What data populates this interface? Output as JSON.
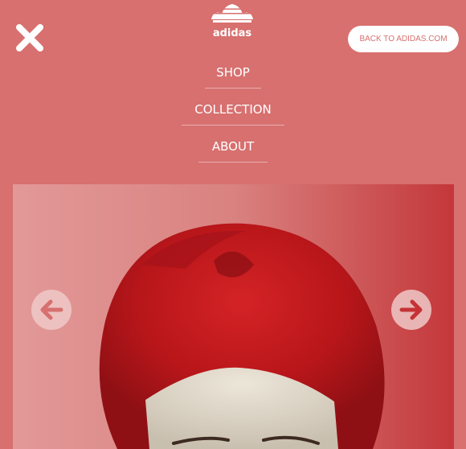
{
  "header": {
    "logo_text": "adidas",
    "back_label": "BACK TO ADIDAS.COM"
  },
  "nav": {
    "items": [
      {
        "label": "SHOP"
      },
      {
        "label": "COLLECTION"
      },
      {
        "label": "ABOUT"
      }
    ]
  },
  "icons": {
    "close": "close-icon",
    "prev": "arrow-left-icon",
    "next": "arrow-right-icon",
    "logo": "adidas-trefoil-logo"
  },
  "colors": {
    "background": "#d7706f",
    "hair_red": "#c0191c",
    "white": "#ffffff"
  },
  "carousel": {
    "image": "red-haired-woman-photo"
  }
}
